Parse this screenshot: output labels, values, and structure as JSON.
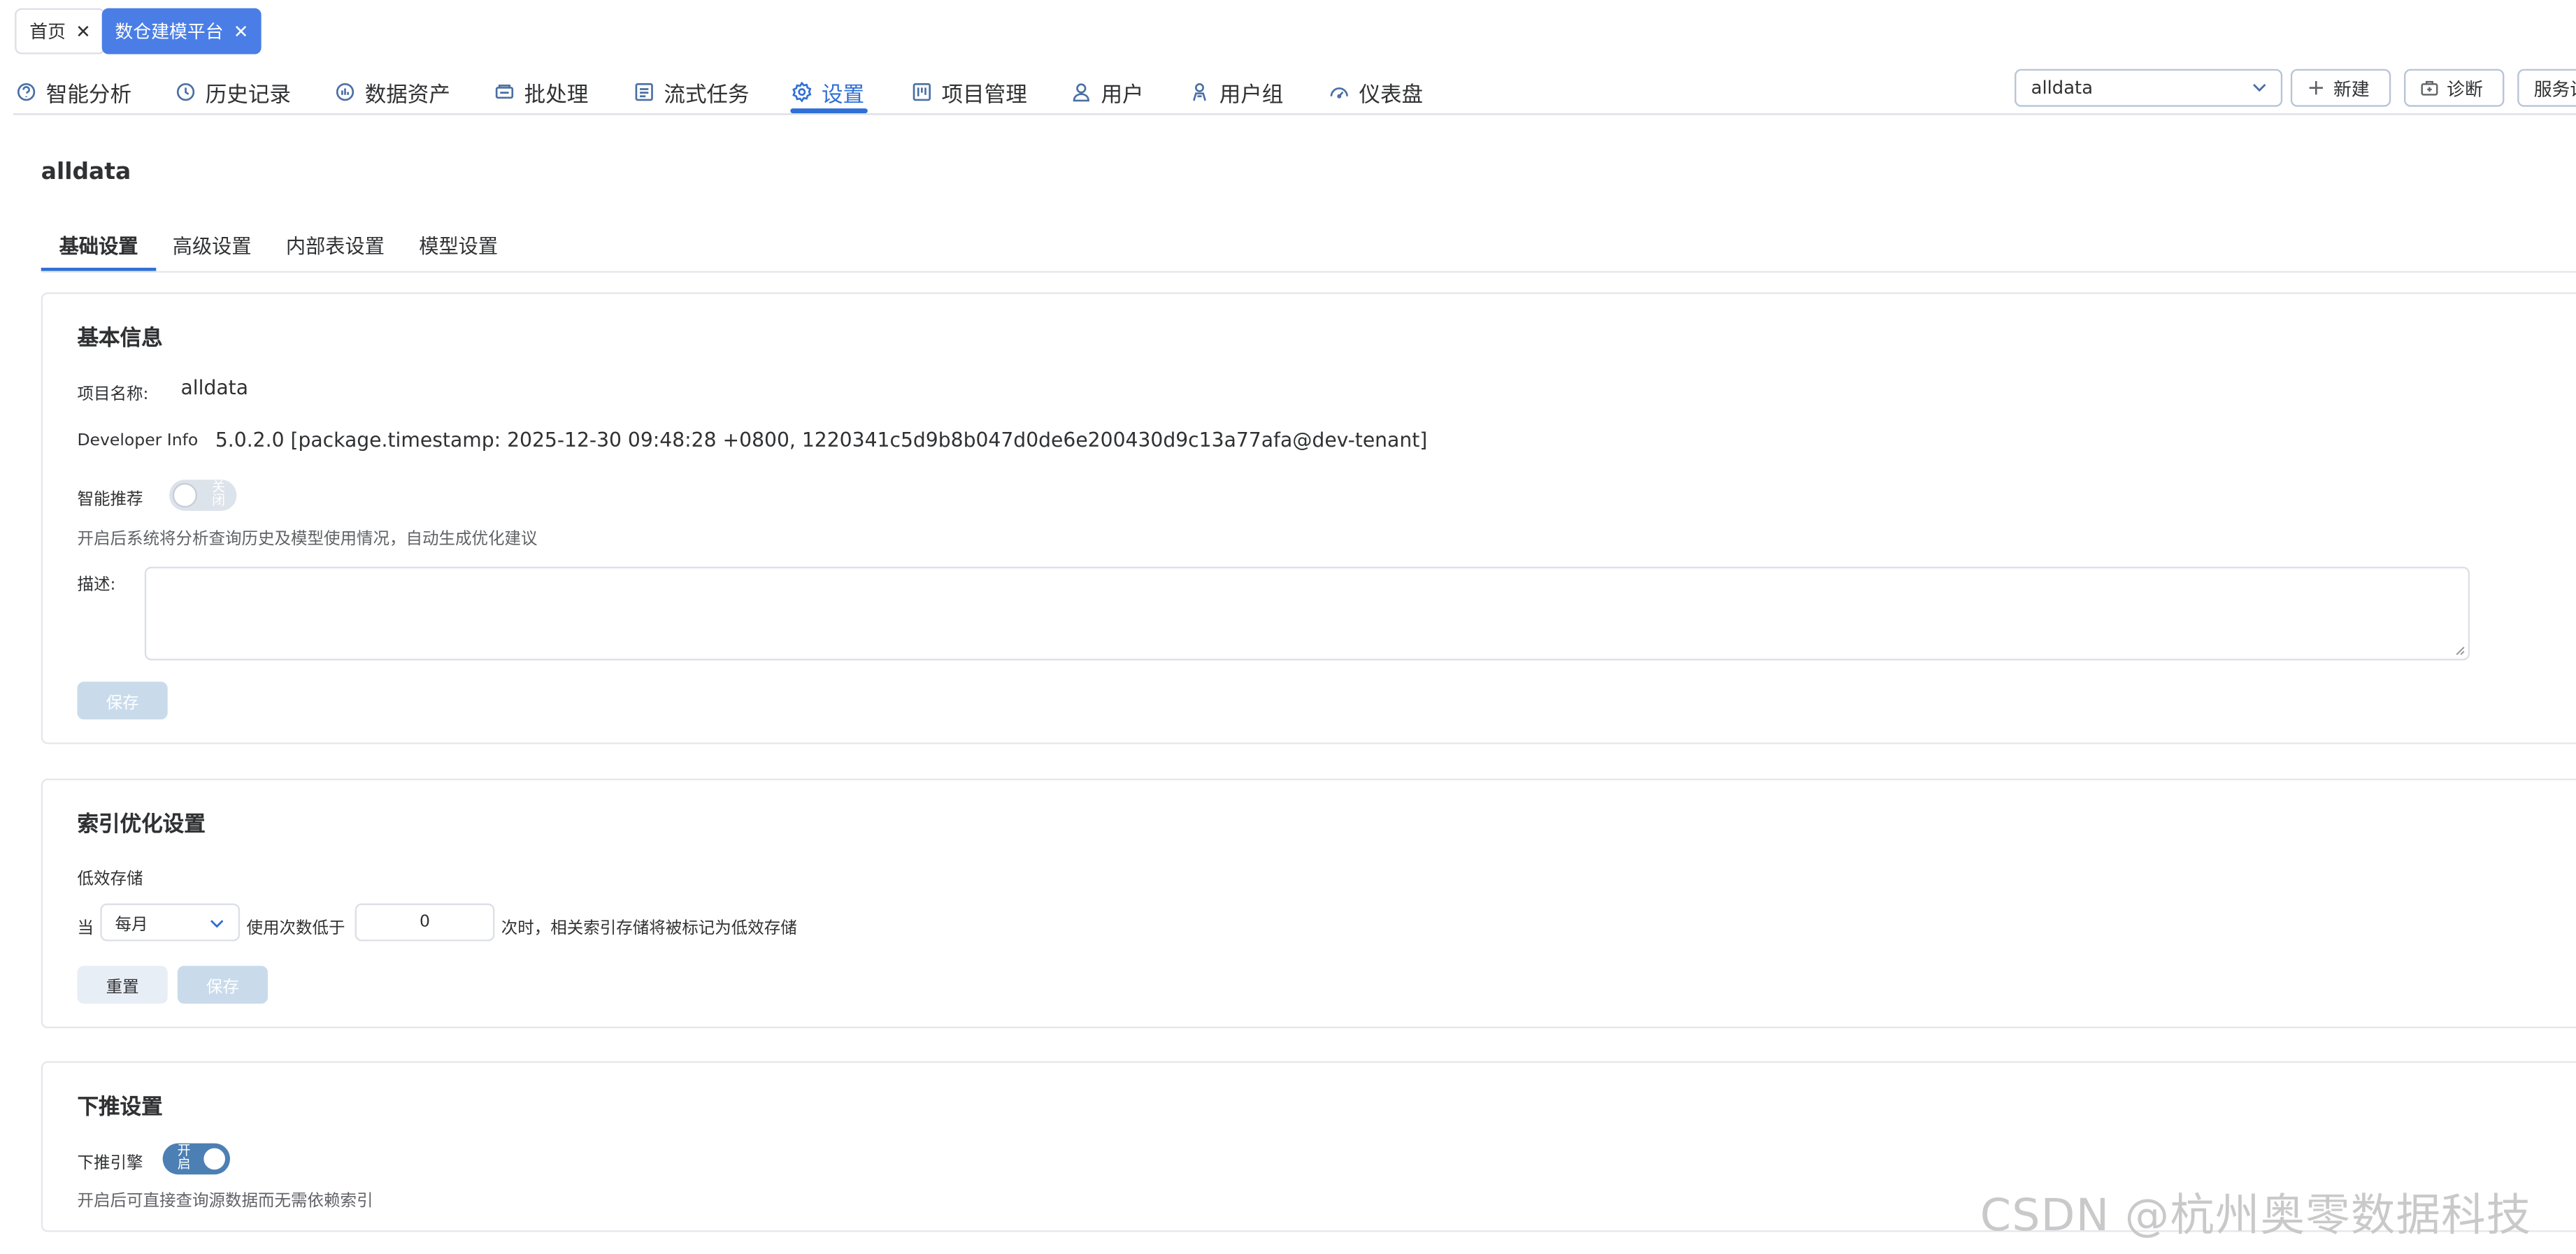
{
  "page_tabs": [
    {
      "label": "首页",
      "active": false
    },
    {
      "label": "数仓建模平台",
      "active": true
    }
  ],
  "nav": {
    "items": [
      {
        "label": "智能分析",
        "icon": "brain-icon"
      },
      {
        "label": "历史记录",
        "icon": "clock-icon"
      },
      {
        "label": "数据资产",
        "icon": "data-assets-icon"
      },
      {
        "label": "批处理",
        "icon": "batch-icon"
      },
      {
        "label": "流式任务",
        "icon": "stream-icon"
      },
      {
        "label": "设置",
        "icon": "gear-icon",
        "active": true
      },
      {
        "label": "项目管理",
        "icon": "kanban-icon"
      },
      {
        "label": "用户",
        "icon": "user-icon"
      },
      {
        "label": "用户组",
        "icon": "user-group-icon"
      },
      {
        "label": "仪表盘",
        "icon": "dashboard-icon"
      }
    ],
    "project_select": "alldata",
    "new_button": "新建",
    "diagnose_button": "诊断",
    "service_button": "服务设"
  },
  "page_title": "alldata",
  "settings_tabs": [
    {
      "label": "基础设置",
      "active": true
    },
    {
      "label": "高级设置"
    },
    {
      "label": "内部表设置"
    },
    {
      "label": "模型设置"
    }
  ],
  "basic_info": {
    "title": "基本信息",
    "project_name_label": "项目名称:",
    "project_name_value": "alldata",
    "developer_info_label": "Developer Info",
    "developer_info_value": "5.0.2.0 [package.timestamp: 2025-12-30 09:48:28 +0800, 1220341c5d9b8b047d0de6e200430d9c13a77afa@dev-tenant]",
    "smart_recommend_label": "智能推荐",
    "smart_recommend_state": "关闭",
    "smart_recommend_hint": "开启后系统将分析查询历史及模型使用情况，自动生成优化建议",
    "description_label": "描述:",
    "description_value": "",
    "save_button": "保存"
  },
  "index_optimization": {
    "title": "索引优化设置",
    "low_efficiency_label": "低效存储",
    "prefix": "当",
    "frequency": "每月",
    "middle_text": "使用次数低于",
    "threshold": "0",
    "suffix": "次时，相关索引存储将被标记为低效存储",
    "reset_button": "重置",
    "save_button": "保存"
  },
  "pushdown": {
    "title": "下推设置",
    "engine_label": "下推引擎",
    "engine_state": "开启",
    "hint": "开启后可直接查询源数据而无需依赖索引"
  },
  "watermark": "CSDN @杭州奥零数据科技",
  "colors": {
    "primary": "#2f6fd6",
    "tab_active_bg": "#4a7ee6",
    "switch_on": "#4c7fb4",
    "disabled_button": "#c9dbeb"
  }
}
